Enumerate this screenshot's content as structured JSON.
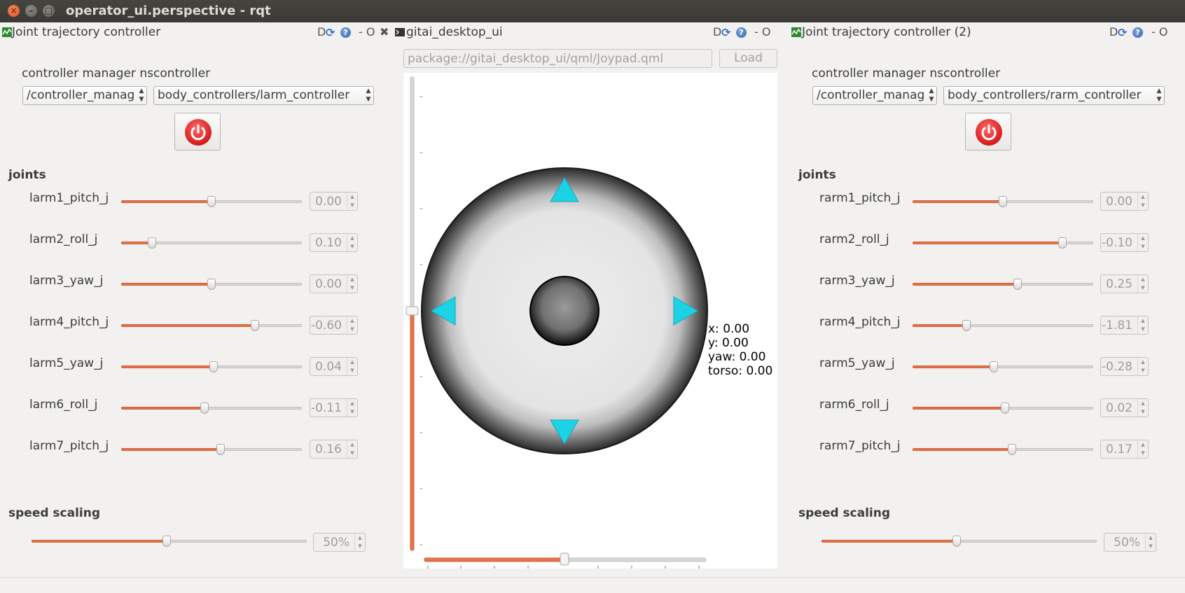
{
  "window": {
    "title": "operator_ui.perspective - rqt"
  },
  "left_panel": {
    "title": "Joint trajectory controller",
    "buttons": {
      "d": "D",
      "c": "C",
      "help": "?",
      "float": "- O",
      "close": "✖"
    },
    "cm_label": "controller manager ns",
    "controller_label": "controller",
    "cm_value": "/controller_manag",
    "controller_value": "body_controllers/larm_controller",
    "joints_heading": "joints",
    "joints": [
      {
        "name": "larm1_pitch_j",
        "value": "0.00",
        "fraction": 0.5
      },
      {
        "name": "larm2_roll_j",
        "value": "0.10",
        "fraction": 0.17
      },
      {
        "name": "larm3_yaw_j",
        "value": "0.00",
        "fraction": 0.5
      },
      {
        "name": "larm4_pitch_j",
        "value": "-0.60",
        "fraction": 0.74
      },
      {
        "name": "larm5_yaw_j",
        "value": "0.04",
        "fraction": 0.51
      },
      {
        "name": "larm6_roll_j",
        "value": "-0.11",
        "fraction": 0.46
      },
      {
        "name": "larm7_pitch_j",
        "value": "0.16",
        "fraction": 0.55
      }
    ],
    "speed_heading": "speed scaling",
    "speed_value": "50%",
    "speed_fraction": 0.49
  },
  "center_panel": {
    "title": "gitai_desktop_ui",
    "buttons": {
      "d": "D",
      "c": "C",
      "help": "?",
      "float": "- O",
      "close": "✖"
    },
    "qml_path": "package://gitai_desktop_ui/qml/Joypad.qml",
    "load_label": "Load",
    "readout": {
      "x": "x: 0.00",
      "y": "y: 0.00",
      "yaw": "yaw: 0.00",
      "torso": "torso: 0.00"
    },
    "vertical_slider_fraction": 0.5,
    "horizontal_slider_fraction": 0.5
  },
  "right_panel": {
    "title": "Joint trajectory controller (2)",
    "buttons": {
      "d": "D",
      "c": "C",
      "help": "?",
      "float": "- O",
      "close": "✖"
    },
    "cm_label": "controller manager ns",
    "controller_label": "controller",
    "cm_value": "/controller_manag",
    "controller_value": "body_controllers/rarm_controller",
    "joints_heading": "joints",
    "joints": [
      {
        "name": "rarm1_pitch_j",
        "value": "0.00",
        "fraction": 0.5
      },
      {
        "name": "rarm2_roll_j",
        "value": "-0.10",
        "fraction": 0.83
      },
      {
        "name": "rarm3_yaw_j",
        "value": "0.25",
        "fraction": 0.58
      },
      {
        "name": "rarm4_pitch_j",
        "value": "-1.81",
        "fraction": 0.3
      },
      {
        "name": "rarm5_yaw_j",
        "value": "-0.28",
        "fraction": 0.45
      },
      {
        "name": "rarm6_roll_j",
        "value": "0.02",
        "fraction": 0.51
      },
      {
        "name": "rarm7_pitch_j",
        "value": "0.17",
        "fraction": 0.55
      }
    ],
    "speed_heading": "speed scaling",
    "speed_value": "50%",
    "speed_fraction": 0.49
  },
  "colors": {
    "slider_fill": "#e8744a",
    "power_red": "#d81b1b",
    "arrow_cyan": "#1ed2e6"
  },
  "icons": [
    "window-close-icon",
    "window-minimize-icon",
    "window-maximize-icon",
    "plugin-icon",
    "refresh-icon",
    "help-icon",
    "power-icon",
    "arrow-up-icon",
    "arrow-down-icon",
    "arrow-left-icon",
    "arrow-right-icon"
  ]
}
